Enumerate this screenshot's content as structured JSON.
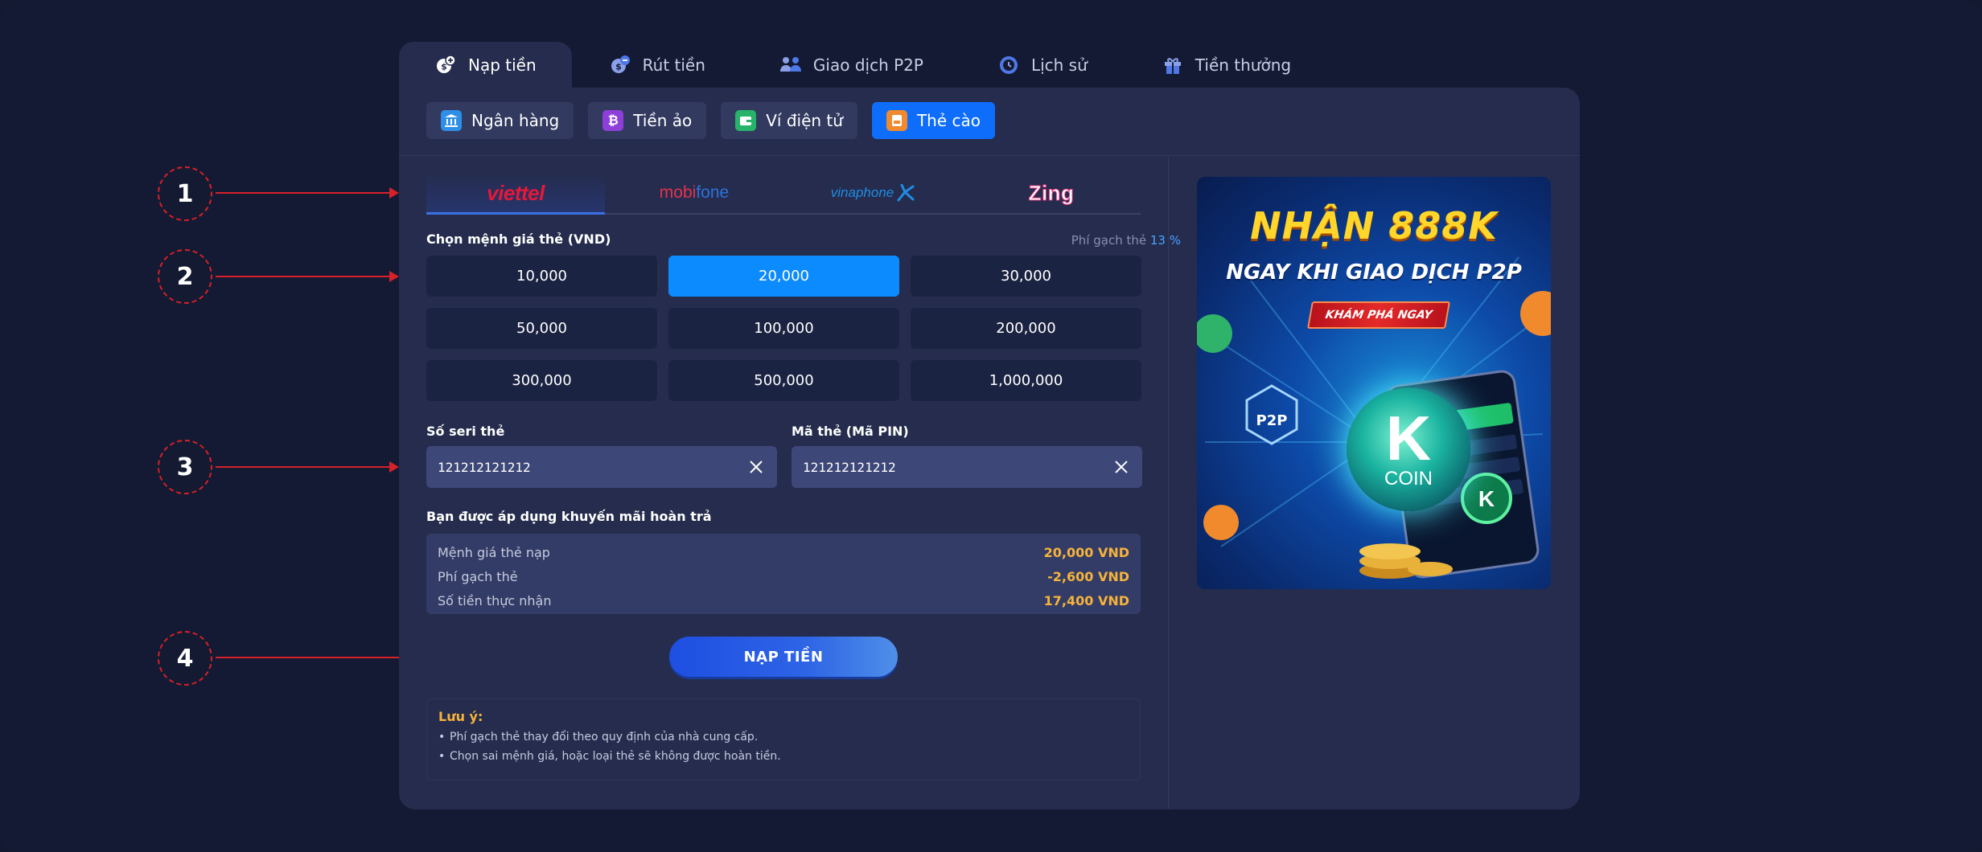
{
  "main_tabs": [
    {
      "label": "Nạp tiền",
      "icon": "deposit-icon",
      "active": true
    },
    {
      "label": "Rút tiền",
      "icon": "withdraw-icon",
      "active": false
    },
    {
      "label": "Giao dịch P2P",
      "icon": "p2p-users-icon",
      "active": false
    },
    {
      "label": "Lịch sử",
      "icon": "history-icon",
      "active": false
    },
    {
      "label": "Tiền thưởng",
      "icon": "gift-icon",
      "active": false
    }
  ],
  "sub_tabs": [
    {
      "label": "Ngân hàng",
      "icon": "bank-icon",
      "active": false
    },
    {
      "label": "Tiền ảo",
      "icon": "bitcoin-icon",
      "active": false
    },
    {
      "label": "Ví điện tử",
      "icon": "wallet-icon",
      "active": false
    },
    {
      "label": "Thẻ cào",
      "icon": "scratch-card-icon",
      "active": true
    }
  ],
  "providers": [
    {
      "name": "viettel",
      "active": true
    },
    {
      "name": "mobifone",
      "active": false
    },
    {
      "name": "vinaphone",
      "active": false
    },
    {
      "name": "Zing",
      "active": false
    }
  ],
  "amount_section": {
    "label": "Chọn mệnh giá thẻ (VND)",
    "fee_label": "Phí gạch thẻ",
    "fee_value": "13 %",
    "options": [
      "10,000",
      "20,000",
      "30,000",
      "50,000",
      "100,000",
      "200,000",
      "300,000",
      "500,000",
      "1,000,000"
    ],
    "selected": "20,000"
  },
  "serial_field": {
    "label": "Số seri thẻ",
    "value": "121212121212"
  },
  "pin_field": {
    "label": "Mã thẻ (Mã PIN)",
    "value": "121212121212"
  },
  "summary": {
    "title": "Bạn được áp dụng khuyến mãi hoàn trả",
    "rows": [
      {
        "label": "Mệnh giá thẻ nạp",
        "value": "20,000 VND"
      },
      {
        "label": "Phí gạch thẻ",
        "value": "-2,600 VND"
      },
      {
        "label": "Số tiền thực nhận",
        "value": "17,400 VND"
      }
    ]
  },
  "submit_label": "NẠP TIỀN",
  "notes": {
    "title": "Lưu ý:",
    "items": [
      "Phí gạch thẻ thay đổi theo quy định của nhà cung cấp.",
      "Chọn sai mệnh giá, hoặc loại thẻ sẽ không được hoàn tiền."
    ]
  },
  "promo": {
    "headline": "NHẬN 888K",
    "subheadline": "NGAY KHI GIAO DỊCH P2P",
    "cta": "KHÁM PHÁ NGAY",
    "badge": "P2P",
    "coin_letter": "K",
    "coin_label": "COIN"
  },
  "markers": [
    "1",
    "2",
    "3",
    "4"
  ],
  "colors": {
    "accent": "#0f6dfb",
    "selected_amount": "#0c8bff",
    "highlight": "#f6b33b",
    "marker": "#d6202a"
  }
}
